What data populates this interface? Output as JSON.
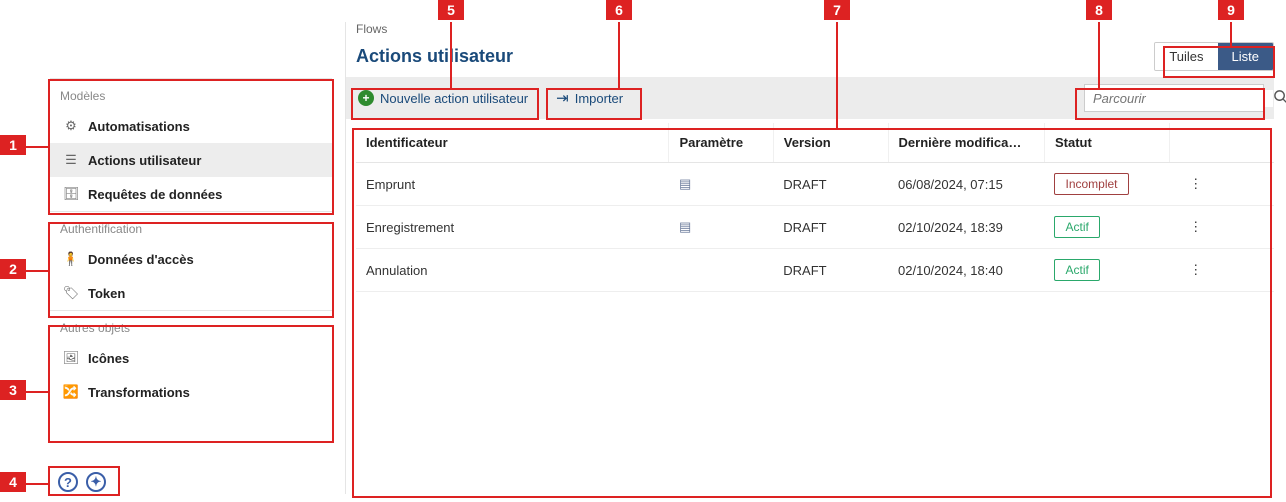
{
  "sidebar": {
    "sections": [
      {
        "title": "Modèles",
        "items": [
          {
            "label": "Automatisations",
            "icon": "automation"
          },
          {
            "label": "Actions utilisateur",
            "icon": "user-action",
            "active": true
          },
          {
            "label": "Requêtes de données",
            "icon": "data-request"
          }
        ]
      },
      {
        "title": "Authentification",
        "items": [
          {
            "label": "Données d'accès",
            "icon": "key"
          },
          {
            "label": "Token",
            "icon": "tag"
          }
        ]
      },
      {
        "title": "Autres objets",
        "items": [
          {
            "label": "Icônes",
            "icon": "image"
          },
          {
            "label": "Transformations",
            "icon": "shuffle"
          }
        ]
      }
    ]
  },
  "breadcrumb": "Flows",
  "page_title": "Actions utilisateur",
  "view_toggle": {
    "tiles": "Tuiles",
    "list": "Liste"
  },
  "toolbar": {
    "new_action": "Nouvelle action utilisateur",
    "import": "Importer"
  },
  "search": {
    "placeholder": "Parcourir"
  },
  "columns": {
    "id": "Identificateur",
    "param": "Paramètre",
    "version": "Version",
    "modified": "Dernière modifica…",
    "status": "Statut"
  },
  "status_labels": {
    "incomplet": "Incomplet",
    "actif": "Actif"
  },
  "rows": [
    {
      "id": "Emprunt",
      "param": true,
      "version": "DRAFT",
      "modified": "06/08/2024, 07:15",
      "status": "incomplet"
    },
    {
      "id": "Enregistrement",
      "param": true,
      "version": "DRAFT",
      "modified": "02/10/2024, 18:39",
      "status": "actif"
    },
    {
      "id": "Annulation",
      "param": false,
      "version": "DRAFT",
      "modified": "02/10/2024, 18:40",
      "status": "actif"
    }
  ],
  "callouts": [
    "1",
    "2",
    "3",
    "4",
    "5",
    "6",
    "7",
    "8",
    "9"
  ]
}
